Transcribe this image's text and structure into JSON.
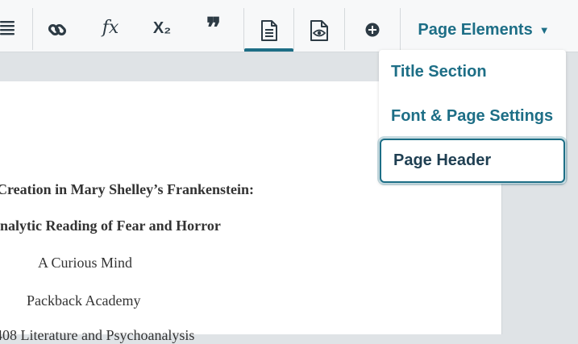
{
  "toolbar": {
    "items": [
      {
        "name": "list-icon",
        "label": ""
      },
      {
        "name": "link-icon",
        "label": ""
      },
      {
        "name": "formula-icon",
        "label": "fx"
      },
      {
        "name": "subscript-icon",
        "label": "X₂"
      },
      {
        "name": "quote-icon",
        "label": "❞"
      },
      {
        "name": "document-icon",
        "label": "",
        "active": true
      },
      {
        "name": "preview-icon",
        "label": ""
      },
      {
        "name": "add-icon",
        "label": ""
      }
    ],
    "page_elements_label": "Page Elements",
    "caret": "▼"
  },
  "dropdown": {
    "items": [
      {
        "label": "Title Section",
        "selected": false
      },
      {
        "label": "Font & Page Settings",
        "selected": false
      },
      {
        "label": "Page Header",
        "selected": true
      }
    ]
  },
  "document": {
    "lines": [
      {
        "text": "Creation in Mary Shelley’s Frankenstein:",
        "bold": true
      },
      {
        "text": "nalytic Reading of Fear and Horror",
        "bold": true
      },
      {
        "text": "A Curious Mind",
        "bold": false
      },
      {
        "text": "Packback Academy",
        "bold": false
      },
      {
        "text": "408 Literature and Psychoanalysis",
        "bold": false
      }
    ]
  },
  "colors": {
    "accent": "#1d6e86",
    "menu_selected_text": "#1f3f52",
    "toolbar_bg": "#f7f8f9",
    "background": "#dfe3e6"
  }
}
